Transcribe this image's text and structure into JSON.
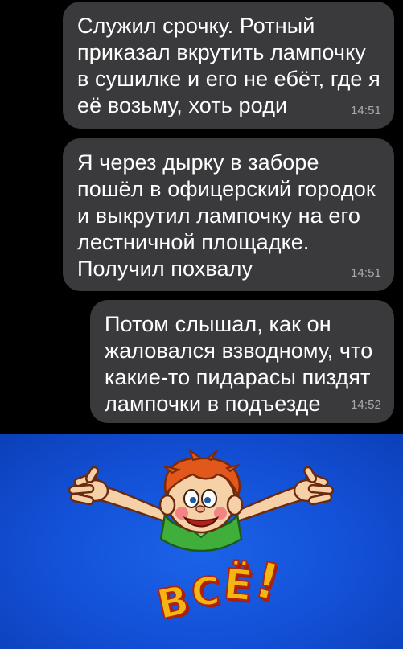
{
  "messages": [
    {
      "lines": [
        "Служил срочку. Ротный",
        "приказал вкрутить лампочку",
        "в сушилке и его не ебёт, где я",
        "её возьму, хоть роди"
      ],
      "time": "14:51"
    },
    {
      "lines": [
        "Я через дырку в заборе",
        "пошёл в офицерский городок",
        "и выкрутил лампочку на его",
        "лестничной площадке.",
        "Получил похвалу"
      ],
      "time": "14:51"
    },
    {
      "lines": [
        "Потом слышал, как он",
        "жаловался взводному, что",
        "какие-то пидарасы пиздят",
        "лампочки в подъезде"
      ],
      "time": "14:52"
    }
  ],
  "sticker": {
    "letters": [
      "В",
      "С",
      "Ё",
      "!"
    ],
    "colors": {
      "background": "#1350d6",
      "letters": "#f3b613",
      "outline": "#b2240f",
      "hair": "#e2581c"
    }
  }
}
